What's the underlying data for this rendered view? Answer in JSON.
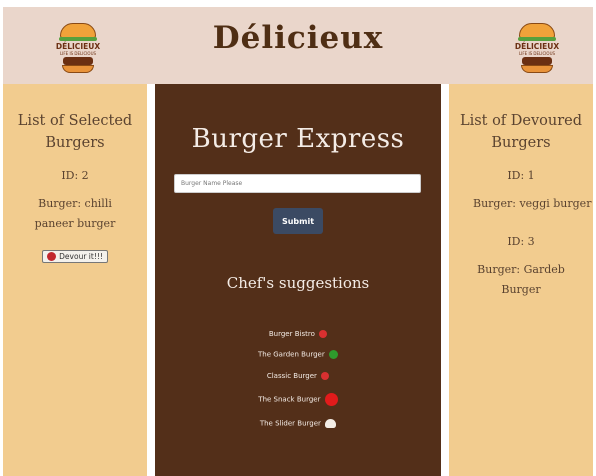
{
  "header": {
    "title": "Délicieux",
    "logo_name": "DÉLICIEUX",
    "logo_tagline": "LIFE IS DELICIOUS"
  },
  "left_column": {
    "title": "List of Selected Burgers",
    "items": [
      {
        "id_text": "ID: 2",
        "burger_text": "Burger: chilli paneer burger",
        "button_label": "Devour it!!!"
      }
    ]
  },
  "center": {
    "title": "Burger Express",
    "input_placeholder": "Burger Name Please",
    "submit_label": "Submit",
    "suggestions_title": "Chef's suggestions",
    "suggestions": [
      {
        "label": "Burger Bistro",
        "icon": "burger-red-small-icon"
      },
      {
        "label": "The Garden Burger",
        "icon": "green-dot-icon"
      },
      {
        "label": "Classic Burger",
        "icon": "burger-red-small-icon"
      },
      {
        "label": "The Snack Burger",
        "icon": "burger-red-large-icon"
      },
      {
        "label": "The Slider Burger",
        "icon": "burger-white-icon"
      }
    ]
  },
  "right_column": {
    "title": "List of Devoured Burgers",
    "items": [
      {
        "id_text": "ID: 1",
        "burger_text": "Burger: veggi burger"
      },
      {
        "id_text": "ID: 3",
        "burger_text": "Burger: Gardeb Burger"
      }
    ]
  },
  "colors": {
    "header_bg": "#ead6cb",
    "side_bg": "#f2cc8f",
    "center_bg": "#532f19",
    "submit_bg": "#3b4a63"
  }
}
